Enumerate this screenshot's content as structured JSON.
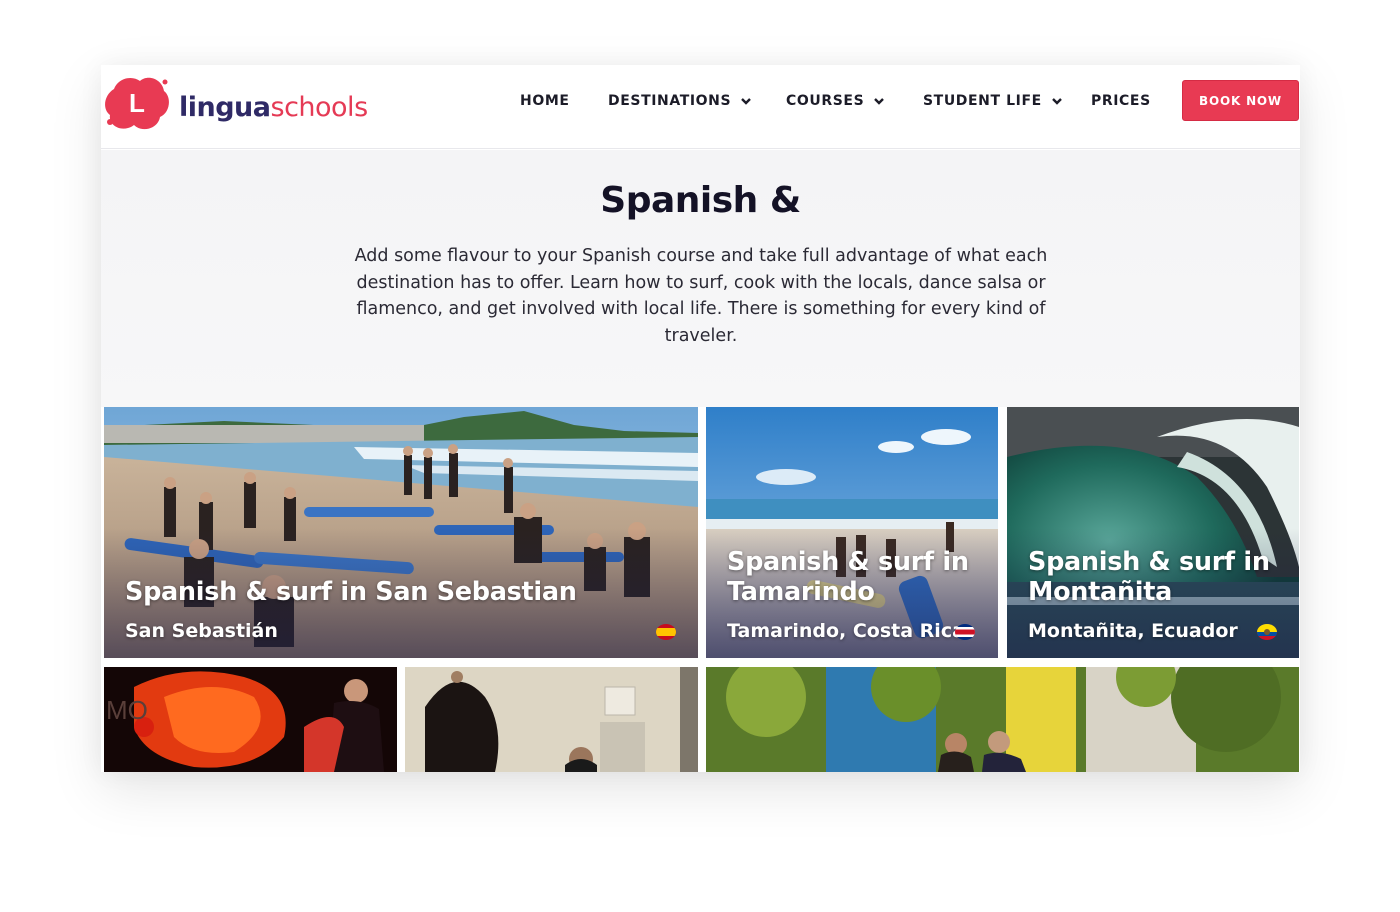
{
  "brand": {
    "logo_letter": "L",
    "name_part1": "lingua",
    "name_part2": "schools",
    "accent_color": "#e83a53",
    "dark_color": "#2f2a66"
  },
  "nav": {
    "items": [
      {
        "label": "HOME",
        "dropdown": false
      },
      {
        "label": "DESTINATIONS",
        "dropdown": true
      },
      {
        "label": "COURSES",
        "dropdown": true
      },
      {
        "label": "STUDENT LIFE",
        "dropdown": true
      },
      {
        "label": "PRICES",
        "dropdown": false
      }
    ],
    "cta_label": "BOOK NOW"
  },
  "intro": {
    "heading": "Spanish &",
    "body": "Add some flavour to your Spanish course and take full advantage of what each destination has to offer. Learn how to surf, cook with the locals, dance salsa or flamenco, and get involved with local life. There is something for every kind of traveler."
  },
  "cards": [
    {
      "title": "Spanish & surf in San Sebastian",
      "place": "San Sebastián",
      "flag": "spain-flag-icon"
    },
    {
      "title": "Spanish & surf in Tamarindo",
      "place": "Tamarindo, Costa Rica",
      "flag": "costa-rica-flag-icon"
    },
    {
      "title": "Spanish & surf in Montañita",
      "place": "Montañita, Ecuador",
      "flag": "ecuador-flag-icon"
    },
    {
      "title": "",
      "place": "",
      "image": "flamenco-dancer-photo"
    },
    {
      "title": "",
      "place": "",
      "image": "cooking-class-photo"
    },
    {
      "title": "",
      "place": "",
      "image": "street-tango-photo"
    }
  ]
}
